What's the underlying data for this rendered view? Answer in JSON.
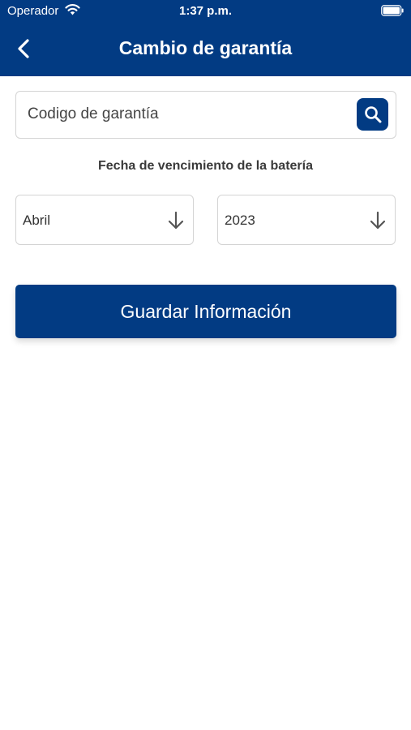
{
  "status_bar": {
    "carrier": "Operador",
    "time": "1:37 p.m."
  },
  "header": {
    "title": "Cambio de garantía"
  },
  "search": {
    "placeholder": "Codigo de garantía"
  },
  "expiry": {
    "label": "Fecha de vencimiento de la batería",
    "month": "Abril",
    "year": "2023"
  },
  "actions": {
    "save_label": "Guardar Información"
  },
  "colors": {
    "brand": "#023b83",
    "border": "#d4d4d4"
  }
}
